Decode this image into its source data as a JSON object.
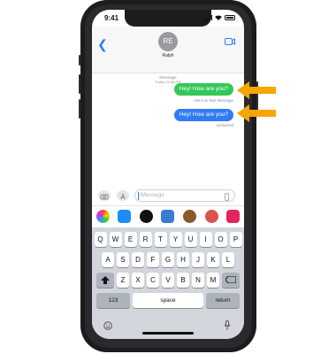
{
  "status": {
    "time": "9:41"
  },
  "header": {
    "back_icon": "chevron-left",
    "avatar_initials": "RE",
    "contact_name": "Ralph",
    "video_icon": "video-camera"
  },
  "thread": {
    "service": "iMessage",
    "timestamp": "Today 12:45 PM",
    "messages": [
      {
        "text": "Hey! How are you?",
        "color": "#34c759"
      },
      {
        "text": "Hey! How are you?",
        "color": "#2f7cf6"
      }
    ],
    "send_note": "Sent as Text Message",
    "delivered": "Delivered"
  },
  "input": {
    "placeholder": "iMessage"
  },
  "app_strip": [
    "photos-icon",
    "app-store-icon",
    "apple-cash-icon",
    "memoji-icon",
    "sticker-icon",
    "game-icon",
    "search-icon"
  ],
  "keyboard": {
    "row1": [
      "Q",
      "W",
      "E",
      "R",
      "T",
      "Y",
      "U",
      "I",
      "O",
      "P"
    ],
    "row2": [
      "A",
      "S",
      "D",
      "F",
      "G",
      "H",
      "J",
      "K",
      "L"
    ],
    "row3": [
      "Z",
      "X",
      "C",
      "V",
      "B",
      "N",
      "M"
    ],
    "numbers_label": "123",
    "space_label": "space",
    "return_label": "return"
  },
  "colors": {
    "accent": "#2f7cf6",
    "sms_green": "#34c759",
    "arrow": "#f7a600"
  }
}
